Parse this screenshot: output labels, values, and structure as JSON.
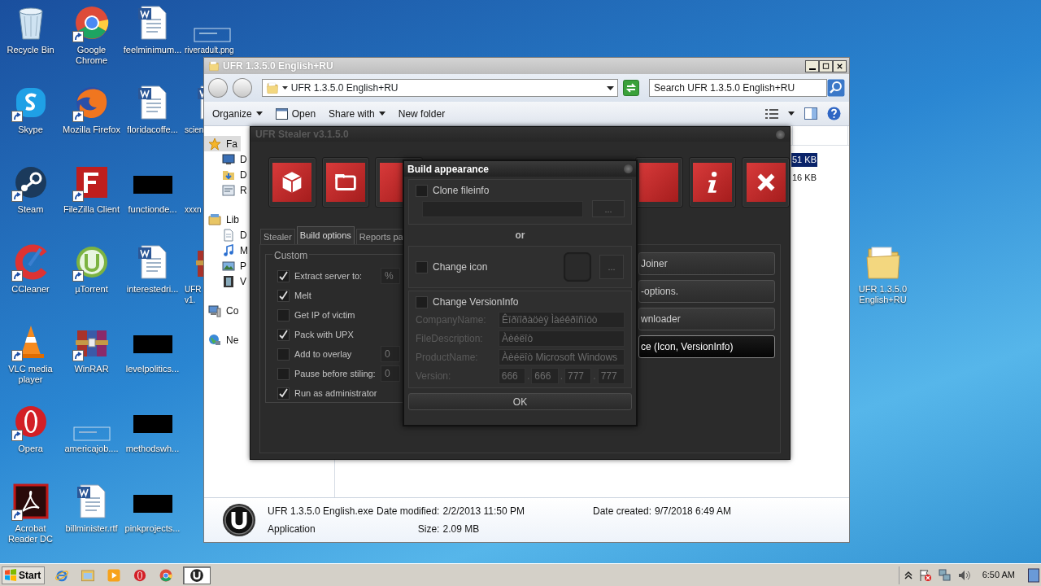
{
  "desktop": {
    "columns": [
      [
        {
          "label": "Recycle Bin",
          "kind": "recycle",
          "shortcut": false
        },
        {
          "label": "Skype",
          "kind": "skype",
          "shortcut": true
        },
        {
          "label": "Steam",
          "kind": "steam",
          "shortcut": true
        },
        {
          "label": "CCleaner",
          "kind": "ccleaner",
          "shortcut": true
        },
        {
          "label": "VLC media player",
          "kind": "vlc",
          "shortcut": true
        },
        {
          "label": "Opera",
          "kind": "opera",
          "shortcut": true
        },
        {
          "label": "Acrobat Reader DC",
          "kind": "acrobat",
          "shortcut": true
        }
      ],
      [
        {
          "label": "Google Chrome",
          "kind": "chrome",
          "shortcut": true
        },
        {
          "label": "Mozilla Firefox",
          "kind": "firefox",
          "shortcut": true
        },
        {
          "label": "FileZilla Client",
          "kind": "filezilla",
          "shortcut": true
        },
        {
          "label": "µTorrent",
          "kind": "utorrent",
          "shortcut": true
        },
        {
          "label": "WinRAR",
          "kind": "winrar",
          "shortcut": true
        },
        {
          "label": "americajob....",
          "kind": "image",
          "shortcut": false
        },
        {
          "label": "billminister.rtf",
          "kind": "word",
          "shortcut": false
        }
      ],
      [
        {
          "label": "feelminimum...",
          "kind": "word",
          "shortcut": false
        },
        {
          "label": "floridacoffe...",
          "kind": "word",
          "shortcut": false
        },
        {
          "label": "functionde...",
          "kind": "redacted",
          "shortcut": false
        },
        {
          "label": "interestedri...",
          "kind": "word",
          "shortcut": false
        },
        {
          "label": "levelpolitics...",
          "kind": "redacted",
          "shortcut": false
        },
        {
          "label": "methodswh...",
          "kind": "redacted",
          "shortcut": false
        },
        {
          "label": "pinkprojects...",
          "kind": "redacted",
          "shortcut": false
        }
      ],
      [
        {
          "label": "riveradult.png",
          "kind": "image",
          "shortcut": false
        },
        {
          "label": "scien",
          "kind": "word",
          "shortcut": false
        },
        {
          "label": "xxxn",
          "kind": "blank"
        },
        {
          "label": "UFR v1.",
          "kind": "winrar",
          "shortcut": false
        }
      ]
    ],
    "right_icons": [
      {
        "label": "UFR 1.3.5.0 English+RU",
        "kind": "folder",
        "shortcut": false
      }
    ]
  },
  "explorer": {
    "title": "UFR 1.3.5.0 English+RU",
    "address": "UFR 1.3.5.0 English+RU",
    "search": {
      "placeholder": "Search UFR 1.3.5.0 English+RU"
    },
    "toolbar": [
      {
        "label": "Organize",
        "kind": "menu"
      },
      {
        "label": "Open",
        "kind": "icon"
      },
      {
        "label": "Share with",
        "kind": "menu"
      },
      {
        "label": "New folder",
        "kind": "plain"
      }
    ],
    "nav": [
      {
        "label": "Fa",
        "kind": "star",
        "selected": true
      },
      {
        "label": "D",
        "kind": "monitor",
        "selected": false
      },
      {
        "label": "D",
        "kind": "download",
        "selected": false
      },
      {
        "label": "R",
        "kind": "places",
        "selected": false
      },
      {
        "label": "Lib",
        "kind": "library",
        "selected": false
      },
      {
        "label": "D",
        "kind": "doc",
        "selected": false
      },
      {
        "label": "M",
        "kind": "music",
        "selected": false
      },
      {
        "label": "P",
        "kind": "pictures",
        "selected": false
      },
      {
        "label": "V",
        "kind": "video",
        "selected": false
      },
      {
        "label": "Co",
        "kind": "computer",
        "selected": false
      },
      {
        "label": "Ne",
        "kind": "network",
        "selected": false
      }
    ],
    "files": [
      {
        "size": "51 KB",
        "selected": true
      },
      {
        "size": "16 KB",
        "selected": false
      }
    ],
    "details": {
      "name": "UFR 1.3.5.0 English.exe",
      "type": "Application",
      "fields": [
        {
          "label": "Date modified:",
          "value": "2/2/2013 11:50 PM"
        },
        {
          "label": "Size:",
          "value": "2.09 MB"
        },
        {
          "label": "Date created:",
          "value": "9/7/2018 6:49 AM"
        }
      ]
    }
  },
  "stealer": {
    "title": "UFR Stealer v3.1.5.0",
    "tiles_left": [
      {
        "kind": "box"
      },
      {
        "kind": "folder"
      },
      {
        "kind": "cut"
      }
    ],
    "tiles_right": [
      {
        "kind": "cut"
      },
      {
        "kind": "info"
      },
      {
        "kind": "close"
      }
    ],
    "tabs": [
      {
        "label": "Stealer",
        "selected": false
      },
      {
        "label": "Build options",
        "selected": true
      },
      {
        "label": "Reports pa",
        "selected": false
      }
    ],
    "custom": {
      "title": "Custom",
      "options": [
        {
          "label": "Extract server to:",
          "checked": true,
          "value": "%"
        },
        {
          "label": "Melt",
          "checked": true
        },
        {
          "label": "Get IP of victim",
          "checked": false
        },
        {
          "label": "Pack with UPX",
          "checked": true
        },
        {
          "label": "Add to overlay",
          "checked": false,
          "value": "0"
        },
        {
          "label": "Pause before stiling:",
          "checked": false,
          "value": "0"
        },
        {
          "label": "Run as administrator",
          "checked": true
        }
      ]
    },
    "actions": [
      {
        "label": "Joiner",
        "selected": false
      },
      {
        "label": "-options.",
        "selected": false
      },
      {
        "label": "wnloader",
        "selected": false
      },
      {
        "label": "ce (Icon, VersionInfo)",
        "selected": true
      }
    ]
  },
  "dialog": {
    "title": "Build appearance",
    "clone": {
      "label": "Clone fileinfo",
      "checked": false,
      "button": "..."
    },
    "separator": "or",
    "icon": {
      "label": "Change icon",
      "checked": false,
      "button": "..."
    },
    "version_info": {
      "label": "Change VersionInfo",
      "checked": false,
      "fields": [
        {
          "label": "CompanyName:",
          "value": "Êîðïîðàöèÿ Ìàéêðîñîôò"
        },
        {
          "label": "FileDescription:",
          "value": "Àèéëîò"
        },
        {
          "label": "ProductName:",
          "value": "Àèéëîò Microsoft Windows"
        }
      ],
      "version_label": "Version:",
      "version": [
        "666",
        "666",
        "777",
        "777"
      ],
      "separators": [
        ".",
        ".",
        "."
      ]
    },
    "ok": "OK"
  },
  "taskbar": {
    "start": "Start",
    "apps": [
      {
        "kind": "ie",
        "selected": false
      },
      {
        "kind": "explorer",
        "selected": false
      },
      {
        "kind": "media",
        "selected": false
      },
      {
        "kind": "opera",
        "selected": false
      },
      {
        "kind": "chrome",
        "selected": false
      },
      {
        "kind": "ufr",
        "selected": true
      }
    ],
    "time": "6:50 AM"
  }
}
